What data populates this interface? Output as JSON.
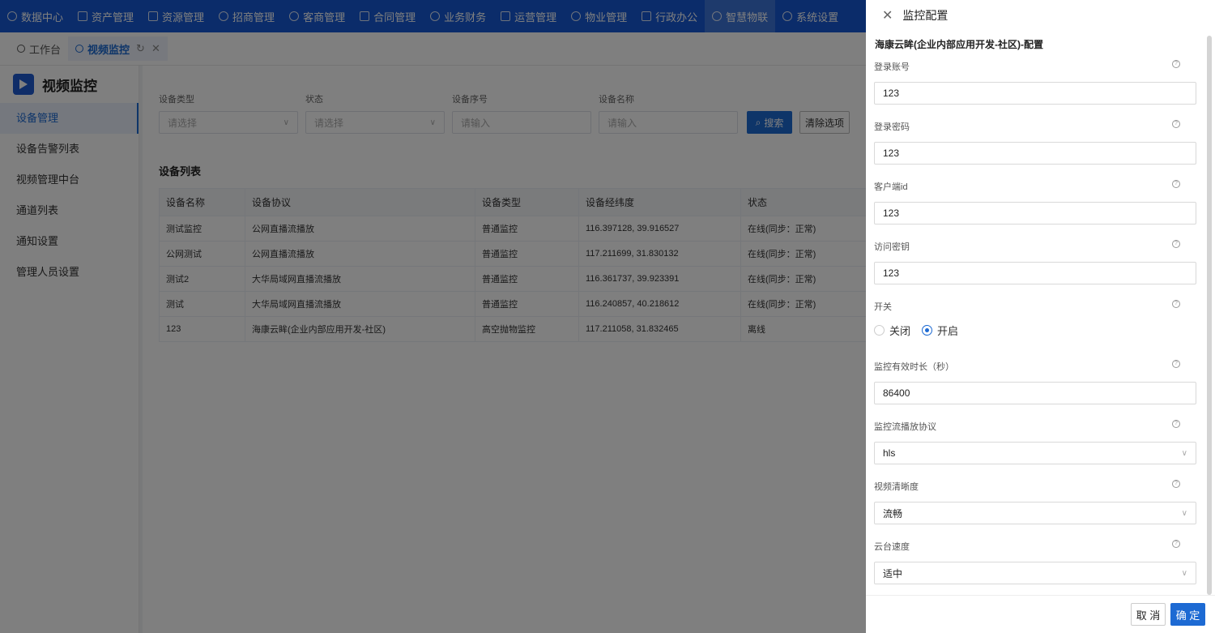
{
  "nav": {
    "items": [
      {
        "label": "数据中心",
        "icon": "clock-icon"
      },
      {
        "label": "资产管理",
        "icon": "box-icon"
      },
      {
        "label": "资源管理",
        "icon": "building-icon"
      },
      {
        "label": "招商管理",
        "icon": "diamond-icon"
      },
      {
        "label": "客商管理",
        "icon": "users-icon"
      },
      {
        "label": "合同管理",
        "icon": "document-icon"
      },
      {
        "label": "业务财务",
        "icon": "yen-icon"
      },
      {
        "label": "运营管理",
        "icon": "image-icon"
      },
      {
        "label": "物业管理",
        "icon": "home-icon"
      },
      {
        "label": "行政办公",
        "icon": "monitor-icon"
      },
      {
        "label": "智慧物联",
        "icon": "asterisk-icon"
      },
      {
        "label": "系统设置",
        "icon": "gear-icon"
      }
    ],
    "active_index": 10,
    "accent": "#1659d4"
  },
  "tabs": [
    {
      "label": "工作台"
    },
    {
      "label": "视频监控"
    }
  ],
  "sidebar": {
    "title": "视频监控",
    "items": [
      "设备管理",
      "设备告警列表",
      "视频管理中台",
      "通道列表",
      "通知设置",
      "管理人员设置"
    ],
    "active_index": 0
  },
  "filters": {
    "device_type": {
      "label": "设备类型",
      "placeholder": "请选择"
    },
    "status": {
      "label": "状态",
      "placeholder": "请选择"
    },
    "serial": {
      "label": "设备序号",
      "placeholder": "请输入"
    },
    "name": {
      "label": "设备名称",
      "placeholder": "请输入"
    },
    "search_label": "搜索",
    "clear_label": "清除选项"
  },
  "device_list": {
    "title": "设备列表",
    "columns": [
      "设备名称",
      "设备协议",
      "设备类型",
      "设备经纬度",
      "状态"
    ],
    "rows": [
      [
        "测试监控",
        "公网直播流播放",
        "普通监控",
        "116.397128, 39.916527",
        "在线(同步：正常)"
      ],
      [
        "公网测试",
        "公网直播流播放",
        "普通监控",
        "117.211699, 31.830132",
        "在线(同步：正常)"
      ],
      [
        "测试2",
        "大华局域网直播流播放",
        "普通监控",
        "116.361737, 39.923391",
        "在线(同步：正常)"
      ],
      [
        "测试",
        "大华局域网直播流播放",
        "普通监控",
        "116.240857, 40.218612",
        "在线(同步：正常)"
      ],
      [
        "123",
        "海康云眸(企业内部应用开发-社区)",
        "高空抛物监控",
        "117.211058, 31.832465",
        "离线"
      ]
    ]
  },
  "drawer": {
    "title": "监控配置",
    "subtitle": "海康云眸(企业内部应用开发-社区)-配置",
    "fields": {
      "account": {
        "label": "登录账号",
        "value": "123"
      },
      "password": {
        "label": "登录密码",
        "value": "123"
      },
      "client_id": {
        "label": "客户端id",
        "value": "123"
      },
      "secret": {
        "label": "访问密钥",
        "value": "123"
      },
      "switch": {
        "label": "开关",
        "off_label": "关闭",
        "on_label": "开启",
        "selected": "开启"
      },
      "duration": {
        "label": "监控有效时长（秒）",
        "value": "86400"
      },
      "protocol": {
        "label": "监控流播放协议",
        "value": "hls"
      },
      "clarity": {
        "label": "视频清晰度",
        "value": "流畅"
      },
      "ptz_speed": {
        "label": "云台速度",
        "value": "适中"
      }
    },
    "cancel_label": "取 消",
    "ok_label": "确 定"
  }
}
